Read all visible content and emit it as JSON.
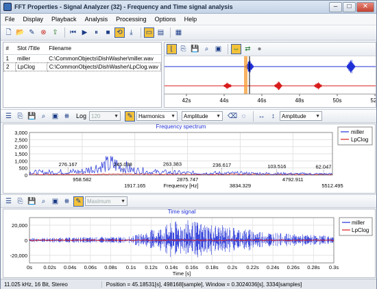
{
  "window": {
    "title": "FFT Properties - Signal Analyzer (32) - Frequency and Time signal analysis"
  },
  "menu": [
    "File",
    "Display",
    "Playback",
    "Analysis",
    "Processing",
    "Options",
    "Help"
  ],
  "file_table": {
    "headers": [
      "#",
      "Slot /Title",
      "Filename"
    ],
    "rows": [
      {
        "num": "1",
        "title": "miller",
        "filename": "C:\\CommonObjects\\DishWasher\\miller.wav"
      },
      {
        "num": "2",
        "title": "LpClog",
        "filename": "C:\\CommonObjects\\DishWasher\\LpClog.wav"
      }
    ]
  },
  "overview": {
    "x_ticks": [
      "42s",
      "44s",
      "46s",
      "48s",
      "50s",
      "52s"
    ],
    "cursor_color": "#f59a2e"
  },
  "freq_toolbar": {
    "log_label": "Log",
    "log_value": "120",
    "harmonics": "Harmonics",
    "amplitude1": "Amplitude",
    "amplitude2": "Amplitude"
  },
  "time_toolbar": {
    "maximum": "Maximum"
  },
  "colors": {
    "miller": "#1f2fd6",
    "lpclog": "#d81b1b"
  },
  "chart_data": [
    {
      "type": "line",
      "title": "Frequency spectrum",
      "xlabel": "Frequency [Hz]",
      "ylabel": "",
      "x_ticks": [
        "958.582",
        "1917.165",
        "2875.747",
        "3834.329",
        "4792.911",
        "5512.495"
      ],
      "xlim": [
        0,
        5512.495
      ],
      "y_ticks": [
        "3,000",
        "2,500",
        "2,000",
        "1,500",
        "1,000",
        "500",
        "0"
      ],
      "ylim": [
        0,
        3000
      ],
      "grid": true,
      "legend_position": "top-right",
      "series": [
        {
          "name": "miller",
          "peaks_hz": [
            [
              276.167,
              380
            ],
            [
              958.582,
              520
            ],
            [
              1245,
              1150
            ],
            [
              1520,
              1600
            ],
            [
              1917.165,
              640
            ],
            [
              2300,
              420
            ],
            [
              2875.747,
              300
            ],
            [
              3834.329,
              260
            ],
            [
              4792.911,
              180
            ],
            [
              5512.495,
              150
            ]
          ]
        },
        {
          "name": "LpClog",
          "peaks_hz": [
            [
              500,
              60
            ],
            [
              2000,
              40
            ],
            [
              4000,
              30
            ]
          ]
        }
      ],
      "annotations": [
        {
          "label": "276.167",
          "x": 700,
          "y": 620
        },
        {
          "label": "245.038",
          "x": 1700,
          "y": 620
        },
        {
          "label": "263.383",
          "x": 2600,
          "y": 650
        },
        {
          "label": "236.617",
          "x": 3500,
          "y": 580
        },
        {
          "label": "103.516",
          "x": 4500,
          "y": 480
        },
        {
          "label": "62.047",
          "x": 5350,
          "y": 450
        }
      ]
    },
    {
      "type": "line",
      "title": "Time signal",
      "xlabel": "Time [s]",
      "ylabel": "",
      "x_ticks": [
        "0s",
        "0.02s",
        "0.04s",
        "0.06s",
        "0.08s",
        "0.1s",
        "0.12s",
        "0.14s",
        "0.16s",
        "0.18s",
        "0.2s",
        "0.22s",
        "0.24s",
        "0.26s",
        "0.28s",
        "0.3s"
      ],
      "xlim": [
        0,
        0.3
      ],
      "y_ticks": [
        "20,000",
        "0",
        "-20,000"
      ],
      "ylim": [
        -30000,
        30000
      ],
      "grid": true,
      "legend_position": "top-right",
      "series": [
        {
          "name": "miller",
          "envelope": [
            [
              0,
              3000
            ],
            [
              0.1,
              5000
            ],
            [
              0.12,
              14000
            ],
            [
              0.15,
              28000
            ],
            [
              0.2,
              18000
            ],
            [
              0.25,
              9000
            ],
            [
              0.3,
              6000
            ]
          ]
        },
        {
          "name": "LpClog",
          "envelope": [
            [
              0,
              800
            ],
            [
              0.3,
              800
            ]
          ]
        }
      ]
    }
  ],
  "status": {
    "left": "11.025 kHz, 16 Bit, Stereo",
    "position": "Position = 45.18531[s], 498168[sample], Window = 0.3024036[s], 3334[samples]"
  }
}
